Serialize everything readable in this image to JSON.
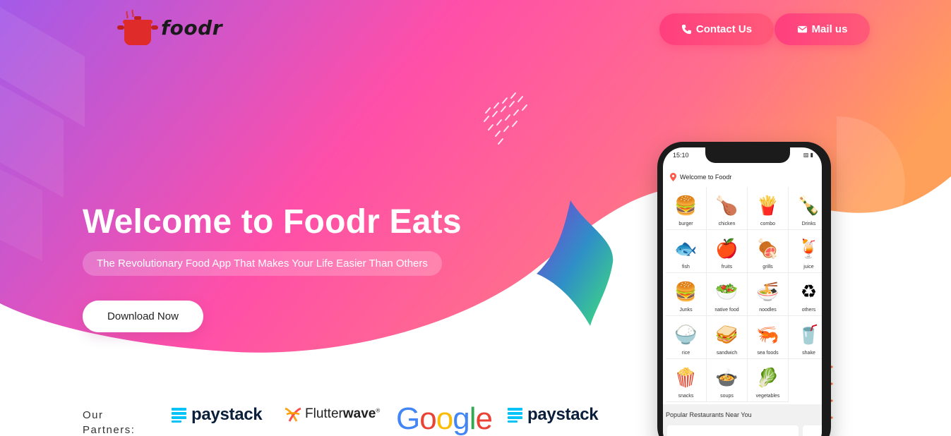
{
  "brand": {
    "name": "foodr"
  },
  "nav": {
    "contact_label": "Contact Us",
    "mail_label": "Mail us"
  },
  "hero": {
    "headline": "Welcome to Foodr Eats",
    "tagline": "The Revolutionary Food App That Makes Your Life Easier Than Others",
    "cta_label": "Download Now"
  },
  "partners": {
    "label": "Our Partners:",
    "items": [
      {
        "name": "paystack"
      },
      {
        "name_light": "Flutter",
        "name_bold": "wave",
        "mark": "®"
      },
      {
        "name": "Google"
      },
      {
        "name": "paystack"
      }
    ]
  },
  "phone": {
    "status_time": "15:10",
    "status_icons": "▨ ▮",
    "app_title": "Welcome to Foodr",
    "categories": [
      {
        "icon": "🍔",
        "label": "burger"
      },
      {
        "icon": "🍗",
        "label": "chicken"
      },
      {
        "icon": "🍟",
        "label": "combo"
      },
      {
        "icon": "🍾",
        "label": "Drinks"
      },
      {
        "icon": "🐟",
        "label": "fish"
      },
      {
        "icon": "🍎",
        "label": "fruits"
      },
      {
        "icon": "🍖",
        "label": "grills"
      },
      {
        "icon": "🍹",
        "label": "juice"
      },
      {
        "icon": "🍔",
        "label": "Junks"
      },
      {
        "icon": "🥗",
        "label": "native food"
      },
      {
        "icon": "🍜",
        "label": "noodles"
      },
      {
        "icon": "♻",
        "label": "others"
      },
      {
        "icon": "🍚",
        "label": "rice"
      },
      {
        "icon": "🥪",
        "label": "sandwich"
      },
      {
        "icon": "🦐",
        "label": "sea foods"
      },
      {
        "icon": "🥤",
        "label": "shake"
      },
      {
        "icon": "🍿",
        "label": "snacks"
      },
      {
        "icon": "🍲",
        "label": "soups"
      },
      {
        "icon": "🥬",
        "label": "vegetables"
      }
    ],
    "popular_title": "Popular Restaurants Near You"
  },
  "colors": {
    "gradient_start": "#a35be8",
    "gradient_mid": "#ff4fa3",
    "gradient_end": "#ff9a5a",
    "button_pink": "#ff3f7f"
  }
}
